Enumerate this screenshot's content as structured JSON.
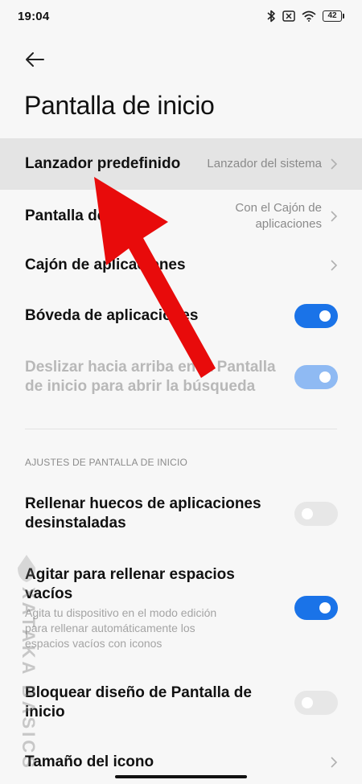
{
  "status_bar": {
    "time": "19:04",
    "battery": "42",
    "icons": [
      "bluetooth-icon",
      "no-sim-icon",
      "wifi-icon",
      "battery-icon"
    ]
  },
  "header": {
    "back_icon": "arrow-left-icon",
    "title": "Pantalla de inicio"
  },
  "settings": {
    "default_launcher": {
      "label": "Lanzador predefinido",
      "value": "Lanzador del sistema"
    },
    "home_screen": {
      "label": "Pantalla de inicio",
      "value_line1": "Con el Cajón de",
      "value_line2": "aplicaciones"
    },
    "app_drawer": {
      "label": "Cajón de aplicaciones"
    },
    "app_vault": {
      "label": "Bóveda de aplicaciones",
      "enabled": true
    },
    "swipe_search": {
      "label_line1": "Deslizar hacia arriba en la Pantalla",
      "label_line2": "de inicio para abrir la búsqueda",
      "enabled": true,
      "disabled": true
    }
  },
  "section": {
    "header": "AJUSTES DE PANTALLA DE INICIO"
  },
  "home_settings": {
    "fill_gaps": {
      "label_line1": "Rellenar huecos de aplicaciones",
      "label_line2": "desinstaladas",
      "enabled": false
    },
    "shake_fill": {
      "label_line1": "Agitar para rellenar espacios",
      "label_line2": "vacíos",
      "desc_line1": "Agita tu dispositivo en el modo edición",
      "desc_line2": "para rellenar automáticamente los",
      "desc_line3": "espacios vacíos con iconos",
      "enabled": true
    },
    "lock_layout": {
      "label_line1": "Bloquear diseño de Pantalla de",
      "label_line2": "inicio",
      "enabled": false
    },
    "icon_size": {
      "label": "Tamaño del icono"
    }
  },
  "watermark": {
    "text": "XATAKA BASICS"
  },
  "colors": {
    "accent": "#1a73e8",
    "annotation_arrow": "#e80b0b"
  }
}
